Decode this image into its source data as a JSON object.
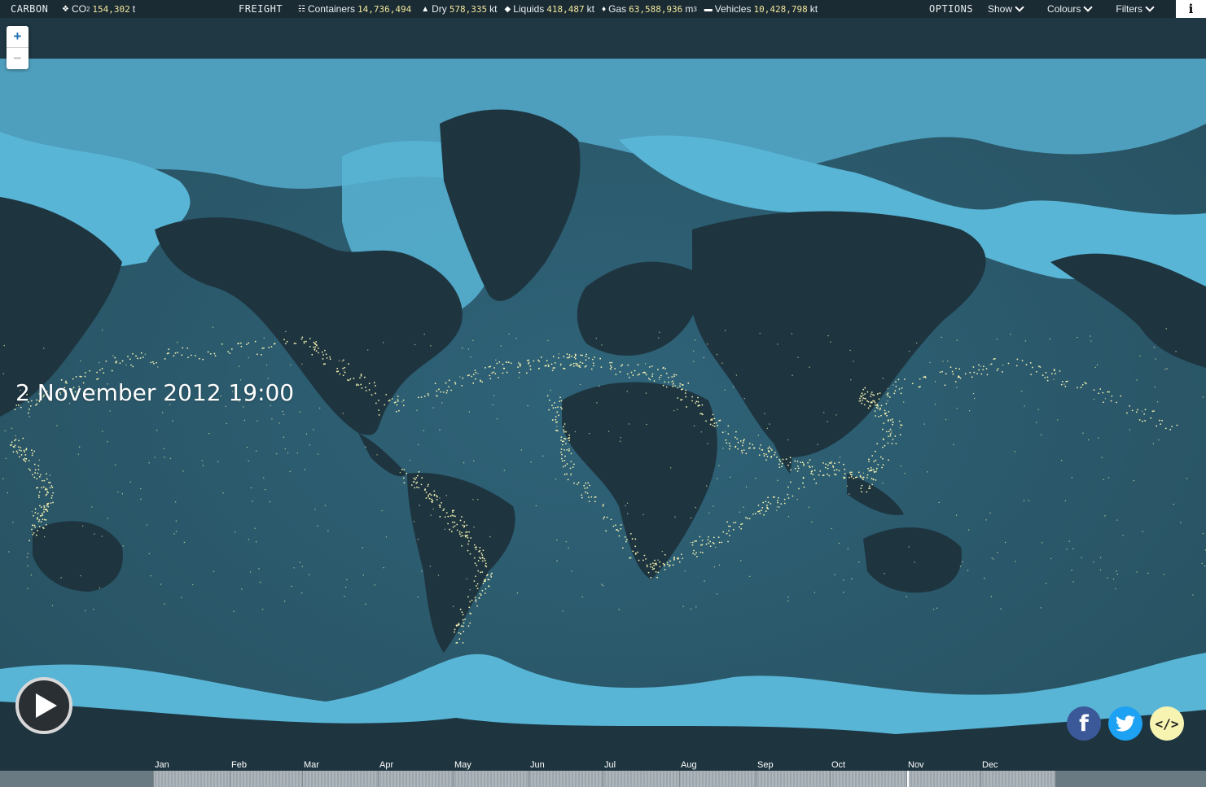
{
  "topbar": {
    "carbon_label": "CARBON",
    "co2": {
      "icon": "drop-icon",
      "label": "CO",
      "sub": "2",
      "value": "154,302",
      "unit": "t"
    },
    "freight_label": "FREIGHT",
    "containers": {
      "icon": "grid-icon",
      "label": "Containers",
      "value": "14,736,494"
    },
    "dry": {
      "icon": "triangle-icon",
      "label": "Dry",
      "value": "578,335",
      "unit": "kt"
    },
    "liquids": {
      "icon": "drop-icon",
      "label": "Liquids",
      "value": "418,487",
      "unit": "kt"
    },
    "gas": {
      "icon": "flame-icon",
      "label": "Gas",
      "value": "63,588,936",
      "unit": "m",
      "sup": "3"
    },
    "vehicles": {
      "icon": "car-icon",
      "label": "Vehicles",
      "value": "10,428,798",
      "unit": "kt"
    },
    "options_label": "OPTIONS",
    "menus": {
      "show": "Show",
      "colours": "Colours",
      "filters": "Filters"
    },
    "info": "i"
  },
  "zoom": {
    "in": "+",
    "out": "−"
  },
  "datestamp": "2 November 2012 19:00",
  "social": {
    "facebook": "f",
    "embed": "</>"
  },
  "timeline": {
    "months": [
      "Jan",
      "Feb",
      "Mar",
      "Apr",
      "May",
      "Jun",
      "Jul",
      "Aug",
      "Sep",
      "Oct",
      "Nov",
      "Dec"
    ],
    "progress": 0.835
  },
  "colors": {
    "ocean": "#2f5d72",
    "land": "#1e3540",
    "ice": "#59b5d6",
    "ship": "#f4f1b0",
    "topbar": "#1b2b33"
  }
}
